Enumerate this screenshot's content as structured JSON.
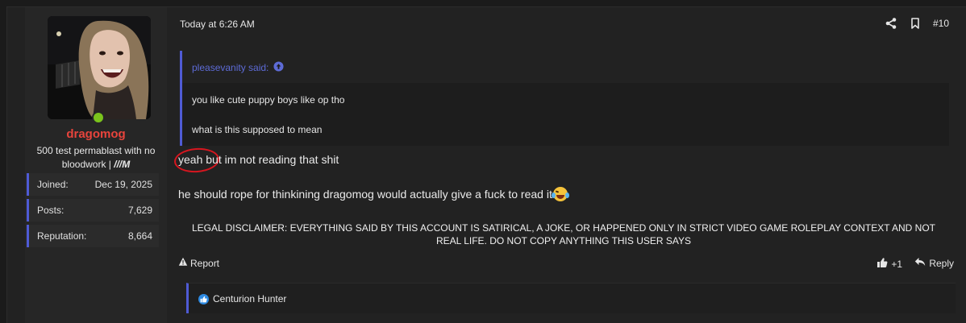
{
  "user": {
    "name": "dragomog",
    "title_prefix": "500 test permablast with no bloodwork | ",
    "title_suffix": "///M",
    "online": true,
    "stats": [
      {
        "label": "Joined:",
        "value": "Dec 19, 2025"
      },
      {
        "label": "Posts:",
        "value": "7,629"
      },
      {
        "label": "Reputation:",
        "value": "8,664"
      }
    ]
  },
  "post": {
    "date": "Today at 6:26 AM",
    "number": "#10",
    "quote": {
      "author": "pleasevanity said:",
      "lines": [
        "you like cute puppy boys like op tho",
        "what is this supposed to mean"
      ]
    },
    "message_line1": "yeah but im not reading that shit",
    "message_line2": "he should rope for thinkining dragomog would actually give a fuck to read it",
    "disclaimer": "LEGAL DISCLAIMER: EVERYTHING SAID BY THIS ACCOUNT IS SATIRICAL, A JOKE, OR HAPPENED ONLY IN STRICT VIDEO GAME ROLEPLAY CONTEXT AND NOT REAL LIFE. DO NOT COPY ANYTHING THIS USER SAYS",
    "report_label": "Report",
    "reaction_label": "+1",
    "reply_label": "Reply",
    "reactions_by": "Centurion Hunter"
  },
  "colors": {
    "accent": "#4f5bd5",
    "username": "#e8443c",
    "online": "#7bc41c",
    "annotation": "#d6161f"
  },
  "icons": [
    "share-icon",
    "bookmark-icon",
    "arrow-up-circle-icon",
    "laughing-emoji-icon",
    "alert-icon",
    "thumbs-up-icon",
    "reply-icon",
    "like-badge-icon"
  ]
}
